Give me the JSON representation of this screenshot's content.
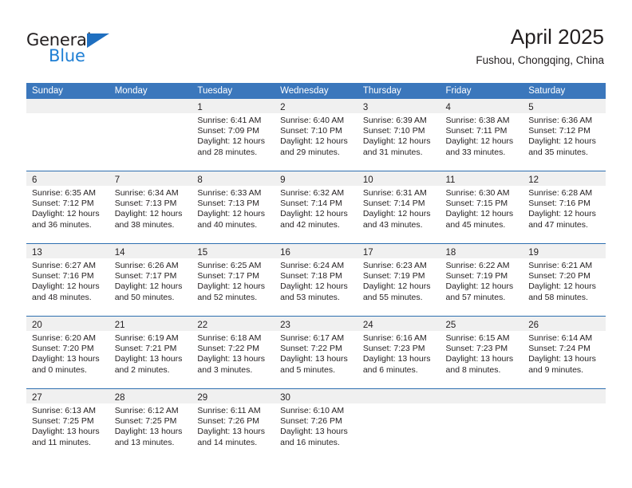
{
  "brand": {
    "name_part1": "General",
    "name_part2": "Blue",
    "triangle_icon": "triangle-icon",
    "accent_color": "#1f7fd4"
  },
  "header": {
    "title": "April 2025",
    "subtitle": "Fushou, Chongqing, China"
  },
  "colors": {
    "header_blue": "#3b77bc",
    "row_separator": "#2e6fb0",
    "daynum_band": "#f0f0f0",
    "text": "#231f20"
  },
  "calendar": {
    "weekday_headers": [
      "Sunday",
      "Monday",
      "Tuesday",
      "Wednesday",
      "Thursday",
      "Friday",
      "Saturday"
    ],
    "weeks": [
      [
        {
          "day": "",
          "sunrise": "",
          "sunset": "",
          "daylight_line1": "",
          "daylight_line2": ""
        },
        {
          "day": "",
          "sunrise": "",
          "sunset": "",
          "daylight_line1": "",
          "daylight_line2": ""
        },
        {
          "day": "1",
          "sunrise": "Sunrise: 6:41 AM",
          "sunset": "Sunset: 7:09 PM",
          "daylight_line1": "Daylight: 12 hours",
          "daylight_line2": "and 28 minutes."
        },
        {
          "day": "2",
          "sunrise": "Sunrise: 6:40 AM",
          "sunset": "Sunset: 7:10 PM",
          "daylight_line1": "Daylight: 12 hours",
          "daylight_line2": "and 29 minutes."
        },
        {
          "day": "3",
          "sunrise": "Sunrise: 6:39 AM",
          "sunset": "Sunset: 7:10 PM",
          "daylight_line1": "Daylight: 12 hours",
          "daylight_line2": "and 31 minutes."
        },
        {
          "day": "4",
          "sunrise": "Sunrise: 6:38 AM",
          "sunset": "Sunset: 7:11 PM",
          "daylight_line1": "Daylight: 12 hours",
          "daylight_line2": "and 33 minutes."
        },
        {
          "day": "5",
          "sunrise": "Sunrise: 6:36 AM",
          "sunset": "Sunset: 7:12 PM",
          "daylight_line1": "Daylight: 12 hours",
          "daylight_line2": "and 35 minutes."
        }
      ],
      [
        {
          "day": "6",
          "sunrise": "Sunrise: 6:35 AM",
          "sunset": "Sunset: 7:12 PM",
          "daylight_line1": "Daylight: 12 hours",
          "daylight_line2": "and 36 minutes."
        },
        {
          "day": "7",
          "sunrise": "Sunrise: 6:34 AM",
          "sunset": "Sunset: 7:13 PM",
          "daylight_line1": "Daylight: 12 hours",
          "daylight_line2": "and 38 minutes."
        },
        {
          "day": "8",
          "sunrise": "Sunrise: 6:33 AM",
          "sunset": "Sunset: 7:13 PM",
          "daylight_line1": "Daylight: 12 hours",
          "daylight_line2": "and 40 minutes."
        },
        {
          "day": "9",
          "sunrise": "Sunrise: 6:32 AM",
          "sunset": "Sunset: 7:14 PM",
          "daylight_line1": "Daylight: 12 hours",
          "daylight_line2": "and 42 minutes."
        },
        {
          "day": "10",
          "sunrise": "Sunrise: 6:31 AM",
          "sunset": "Sunset: 7:14 PM",
          "daylight_line1": "Daylight: 12 hours",
          "daylight_line2": "and 43 minutes."
        },
        {
          "day": "11",
          "sunrise": "Sunrise: 6:30 AM",
          "sunset": "Sunset: 7:15 PM",
          "daylight_line1": "Daylight: 12 hours",
          "daylight_line2": "and 45 minutes."
        },
        {
          "day": "12",
          "sunrise": "Sunrise: 6:28 AM",
          "sunset": "Sunset: 7:16 PM",
          "daylight_line1": "Daylight: 12 hours",
          "daylight_line2": "and 47 minutes."
        }
      ],
      [
        {
          "day": "13",
          "sunrise": "Sunrise: 6:27 AM",
          "sunset": "Sunset: 7:16 PM",
          "daylight_line1": "Daylight: 12 hours",
          "daylight_line2": "and 48 minutes."
        },
        {
          "day": "14",
          "sunrise": "Sunrise: 6:26 AM",
          "sunset": "Sunset: 7:17 PM",
          "daylight_line1": "Daylight: 12 hours",
          "daylight_line2": "and 50 minutes."
        },
        {
          "day": "15",
          "sunrise": "Sunrise: 6:25 AM",
          "sunset": "Sunset: 7:17 PM",
          "daylight_line1": "Daylight: 12 hours",
          "daylight_line2": "and 52 minutes."
        },
        {
          "day": "16",
          "sunrise": "Sunrise: 6:24 AM",
          "sunset": "Sunset: 7:18 PM",
          "daylight_line1": "Daylight: 12 hours",
          "daylight_line2": "and 53 minutes."
        },
        {
          "day": "17",
          "sunrise": "Sunrise: 6:23 AM",
          "sunset": "Sunset: 7:19 PM",
          "daylight_line1": "Daylight: 12 hours",
          "daylight_line2": "and 55 minutes."
        },
        {
          "day": "18",
          "sunrise": "Sunrise: 6:22 AM",
          "sunset": "Sunset: 7:19 PM",
          "daylight_line1": "Daylight: 12 hours",
          "daylight_line2": "and 57 minutes."
        },
        {
          "day": "19",
          "sunrise": "Sunrise: 6:21 AM",
          "sunset": "Sunset: 7:20 PM",
          "daylight_line1": "Daylight: 12 hours",
          "daylight_line2": "and 58 minutes."
        }
      ],
      [
        {
          "day": "20",
          "sunrise": "Sunrise: 6:20 AM",
          "sunset": "Sunset: 7:20 PM",
          "daylight_line1": "Daylight: 13 hours",
          "daylight_line2": "and 0 minutes."
        },
        {
          "day": "21",
          "sunrise": "Sunrise: 6:19 AM",
          "sunset": "Sunset: 7:21 PM",
          "daylight_line1": "Daylight: 13 hours",
          "daylight_line2": "and 2 minutes."
        },
        {
          "day": "22",
          "sunrise": "Sunrise: 6:18 AM",
          "sunset": "Sunset: 7:22 PM",
          "daylight_line1": "Daylight: 13 hours",
          "daylight_line2": "and 3 minutes."
        },
        {
          "day": "23",
          "sunrise": "Sunrise: 6:17 AM",
          "sunset": "Sunset: 7:22 PM",
          "daylight_line1": "Daylight: 13 hours",
          "daylight_line2": "and 5 minutes."
        },
        {
          "day": "24",
          "sunrise": "Sunrise: 6:16 AM",
          "sunset": "Sunset: 7:23 PM",
          "daylight_line1": "Daylight: 13 hours",
          "daylight_line2": "and 6 minutes."
        },
        {
          "day": "25",
          "sunrise": "Sunrise: 6:15 AM",
          "sunset": "Sunset: 7:23 PM",
          "daylight_line1": "Daylight: 13 hours",
          "daylight_line2": "and 8 minutes."
        },
        {
          "day": "26",
          "sunrise": "Sunrise: 6:14 AM",
          "sunset": "Sunset: 7:24 PM",
          "daylight_line1": "Daylight: 13 hours",
          "daylight_line2": "and 9 minutes."
        }
      ],
      [
        {
          "day": "27",
          "sunrise": "Sunrise: 6:13 AM",
          "sunset": "Sunset: 7:25 PM",
          "daylight_line1": "Daylight: 13 hours",
          "daylight_line2": "and 11 minutes."
        },
        {
          "day": "28",
          "sunrise": "Sunrise: 6:12 AM",
          "sunset": "Sunset: 7:25 PM",
          "daylight_line1": "Daylight: 13 hours",
          "daylight_line2": "and 13 minutes."
        },
        {
          "day": "29",
          "sunrise": "Sunrise: 6:11 AM",
          "sunset": "Sunset: 7:26 PM",
          "daylight_line1": "Daylight: 13 hours",
          "daylight_line2": "and 14 minutes."
        },
        {
          "day": "30",
          "sunrise": "Sunrise: 6:10 AM",
          "sunset": "Sunset: 7:26 PM",
          "daylight_line1": "Daylight: 13 hours",
          "daylight_line2": "and 16 minutes."
        },
        {
          "day": "",
          "sunrise": "",
          "sunset": "",
          "daylight_line1": "",
          "daylight_line2": ""
        },
        {
          "day": "",
          "sunrise": "",
          "sunset": "",
          "daylight_line1": "",
          "daylight_line2": ""
        },
        {
          "day": "",
          "sunrise": "",
          "sunset": "",
          "daylight_line1": "",
          "daylight_line2": ""
        }
      ]
    ]
  }
}
